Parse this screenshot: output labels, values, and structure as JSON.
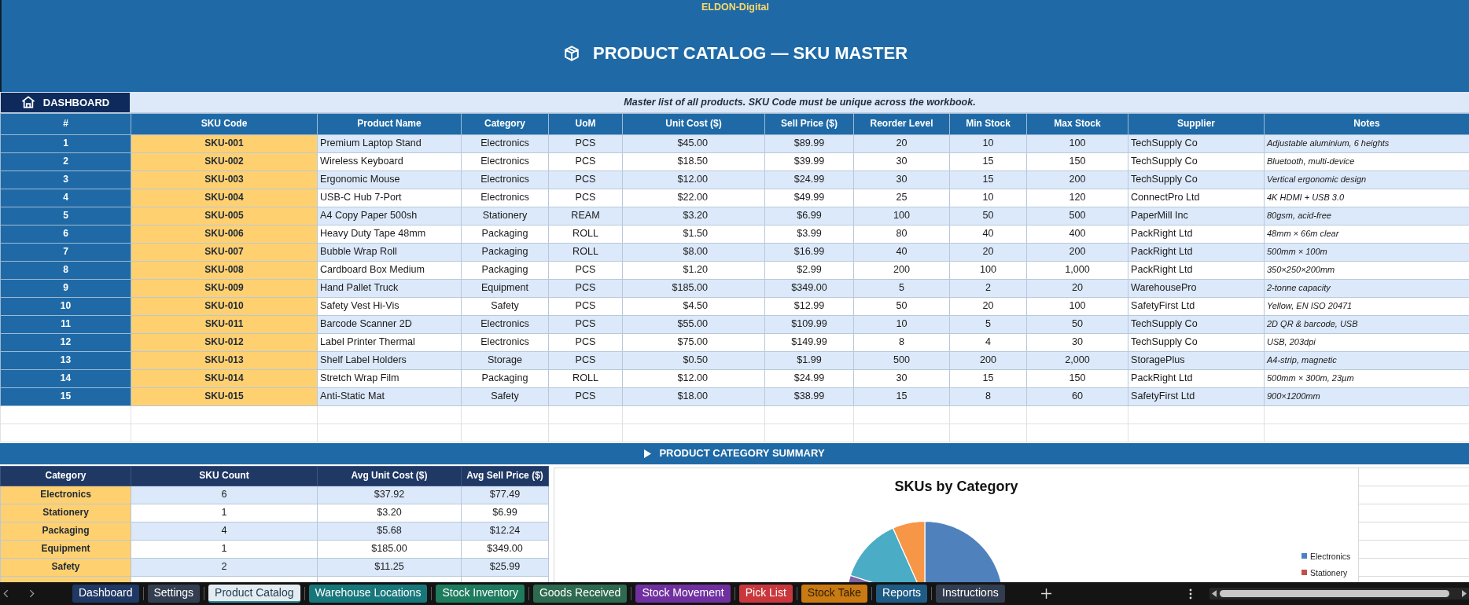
{
  "header": {
    "brand": "ELDON-Digital",
    "title": "PRODUCT CATALOG — SKU MASTER"
  },
  "toolbar": {
    "dashboard_button": "DASHBOARD",
    "note": "Master list of all products. SKU Code must be unique across the workbook."
  },
  "sku_table": {
    "columns": [
      "#",
      "SKU Code",
      "Product Name",
      "Category",
      "UoM",
      "Unit Cost ($)",
      "Sell Price ($)",
      "Reorder Level",
      "Min Stock",
      "Max Stock",
      "Supplier",
      "Notes"
    ],
    "rows": [
      [
        "1",
        "SKU-001",
        "Premium Laptop Stand",
        "Electronics",
        "PCS",
        "$45.00",
        "$89.99",
        "20",
        "10",
        "100",
        "TechSupply Co",
        "Adjustable aluminium, 6 heights"
      ],
      [
        "2",
        "SKU-002",
        "Wireless Keyboard",
        "Electronics",
        "PCS",
        "$18.50",
        "$39.99",
        "30",
        "15",
        "150",
        "TechSupply Co",
        "Bluetooth, multi-device"
      ],
      [
        "3",
        "SKU-003",
        "Ergonomic Mouse",
        "Electronics",
        "PCS",
        "$12.00",
        "$24.99",
        "30",
        "15",
        "200",
        "TechSupply Co",
        "Vertical ergonomic design"
      ],
      [
        "4",
        "SKU-004",
        "USB-C Hub 7-Port",
        "Electronics",
        "PCS",
        "$22.00",
        "$49.99",
        "25",
        "10",
        "120",
        "ConnectPro Ltd",
        "4K HDMI + USB 3.0"
      ],
      [
        "5",
        "SKU-005",
        "A4 Copy Paper 500sh",
        "Stationery",
        "REAM",
        "$3.20",
        "$6.99",
        "100",
        "50",
        "500",
        "PaperMill Inc",
        "80gsm, acid-free"
      ],
      [
        "6",
        "SKU-006",
        "Heavy Duty Tape 48mm",
        "Packaging",
        "ROLL",
        "$1.50",
        "$3.99",
        "80",
        "40",
        "400",
        "PackRight Ltd",
        "48mm × 66m clear"
      ],
      [
        "7",
        "SKU-007",
        "Bubble Wrap Roll",
        "Packaging",
        "ROLL",
        "$8.00",
        "$16.99",
        "40",
        "20",
        "200",
        "PackRight Ltd",
        "500mm × 100m"
      ],
      [
        "8",
        "SKU-008",
        "Cardboard Box Medium",
        "Packaging",
        "PCS",
        "$1.20",
        "$2.99",
        "200",
        "100",
        "1,000",
        "PackRight Ltd",
        "350×250×200mm"
      ],
      [
        "9",
        "SKU-009",
        "Hand Pallet Truck",
        "Equipment",
        "PCS",
        "$185.00",
        "$349.00",
        "5",
        "2",
        "20",
        "WarehousePro",
        "2-tonne capacity"
      ],
      [
        "10",
        "SKU-010",
        "Safety Vest Hi-Vis",
        "Safety",
        "PCS",
        "$4.50",
        "$12.99",
        "50",
        "20",
        "100",
        "SafetyFirst Ltd",
        "Yellow, EN ISO 20471"
      ],
      [
        "11",
        "SKU-011",
        "Barcode Scanner 2D",
        "Electronics",
        "PCS",
        "$55.00",
        "$109.99",
        "10",
        "5",
        "50",
        "TechSupply Co",
        "2D QR & barcode, USB"
      ],
      [
        "12",
        "SKU-012",
        "Label Printer Thermal",
        "Electronics",
        "PCS",
        "$75.00",
        "$149.99",
        "8",
        "4",
        "30",
        "TechSupply Co",
        "USB, 203dpi"
      ],
      [
        "13",
        "SKU-013",
        "Shelf Label Holders",
        "Storage",
        "PCS",
        "$0.50",
        "$1.99",
        "500",
        "200",
        "2,000",
        "StoragePlus",
        "A4-strip, magnetic"
      ],
      [
        "14",
        "SKU-014",
        "Stretch Wrap Film",
        "Packaging",
        "ROLL",
        "$12.00",
        "$24.99",
        "30",
        "15",
        "150",
        "PackRight Ltd",
        "500mm × 300m, 23µm"
      ],
      [
        "15",
        "SKU-015",
        "Anti-Static Mat",
        "Safety",
        "PCS",
        "$18.00",
        "$38.99",
        "15",
        "8",
        "60",
        "SafetyFirst Ltd",
        "900×1200mm"
      ]
    ]
  },
  "summary": {
    "title": "PRODUCT CATEGORY SUMMARY",
    "columns": [
      "Category",
      "SKU Count",
      "Avg Unit Cost ($)",
      "Avg Sell Price ($)"
    ],
    "rows": [
      [
        "Electronics",
        "6",
        "$37.92",
        "$77.49"
      ],
      [
        "Stationery",
        "1",
        "$3.20",
        "$6.99"
      ],
      [
        "Packaging",
        "4",
        "$5.68",
        "$12.24"
      ],
      [
        "Equipment",
        "1",
        "$185.00",
        "$349.00"
      ],
      [
        "Safety",
        "2",
        "$11.25",
        "$25.99"
      ]
    ],
    "chart": {
      "title": "SKUs by Category",
      "legend": [
        {
          "label": "Electronics",
          "color": "#4f81bd"
        },
        {
          "label": "Stationery",
          "color": "#c0504d"
        }
      ]
    }
  },
  "sheet_tabs": [
    {
      "label": "Dashboard",
      "color": "#1f3864",
      "selected": false
    },
    {
      "label": "Settings",
      "color": "#333f50",
      "selected": false
    },
    {
      "label": "Product Catalog",
      "color": "#2e8b9a",
      "selected": true
    },
    {
      "label": "Warehouse Locations",
      "color": "#17777a",
      "selected": false
    },
    {
      "label": "Stock Inventory",
      "color": "#1e7b5e",
      "selected": false
    },
    {
      "label": "Goods Received",
      "color": "#2d6a4f",
      "selected": false
    },
    {
      "label": "Stock Movement",
      "color": "#7030a0",
      "selected": false
    },
    {
      "label": "Pick List",
      "color": "#c9373c",
      "selected": false
    },
    {
      "label": "Stock Take",
      "color": "#c97a12",
      "selected": false
    },
    {
      "label": "Reports",
      "color": "#1f5c85",
      "selected": false
    },
    {
      "label": "Instructions",
      "color": "#323e4f",
      "selected": false
    }
  ]
}
